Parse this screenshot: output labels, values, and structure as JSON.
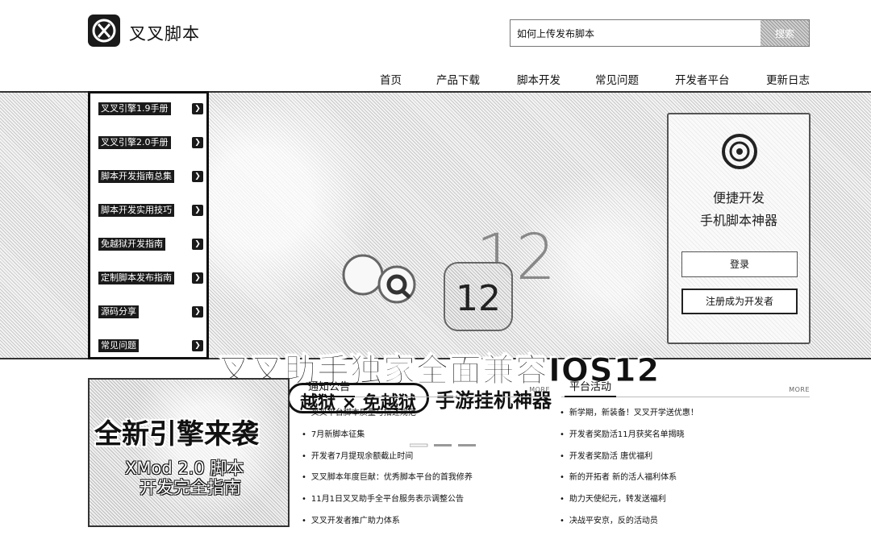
{
  "header": {
    "logo_text": "叉叉脚本",
    "search": {
      "value": "如何上传发布脚本",
      "button_label": "搜索"
    }
  },
  "nav": {
    "items": [
      "首页",
      "产品下载",
      "脚本开发",
      "常见问题",
      "开发者平台",
      "更新日志"
    ]
  },
  "side_menu": {
    "items": [
      "叉叉引擎1.9手册",
      "叉叉引擎2.0手册",
      "脚本开发指南总集",
      "脚本开发实用技巧",
      "免越狱开发指南",
      "定制脚本发布指南",
      "源码分享",
      "常见问题"
    ],
    "arrow_icon": "chevron-right-icon"
  },
  "banner": {
    "ios_number": "12",
    "headline": "叉叉助手独家全面兼容IOS12",
    "pill_text": "越狱 × 免越狱",
    "sub_text": "手游挂机神器"
  },
  "login_card": {
    "title_line1": "便捷开发",
    "title_line2": "手机脚本神器",
    "login_label": "登录",
    "register_label": "注册成为开发者"
  },
  "promo": {
    "title": "全新引擎来袭",
    "line1": "XMod 2.0 脚本",
    "line2": "开发完全指南"
  },
  "notices": {
    "tab_label": "通知公告",
    "more_label": "MORE",
    "items": [
      "叉叉平台脚本质量与描述规范",
      "7月新脚本征集",
      "开发者7月提现余额截止时间",
      "叉叉脚本年度巨献：优秀脚本平台的首我修养",
      "11月1日叉叉助手全平台服务表示调整公告",
      "叉叉开发者推广助力体系"
    ]
  },
  "activities": {
    "tab_label": "平台活动",
    "more_label": "MORE",
    "items": [
      "新学期，新装备！叉叉开学送优惠！",
      "开发者奖励活11月获奖名单揭晓",
      "开发者奖励活 唐优福利",
      "新的开拓者 新的活人福利体系",
      "助力天使纪元，转发送福利",
      "决战平安京，反的活动员"
    ]
  }
}
